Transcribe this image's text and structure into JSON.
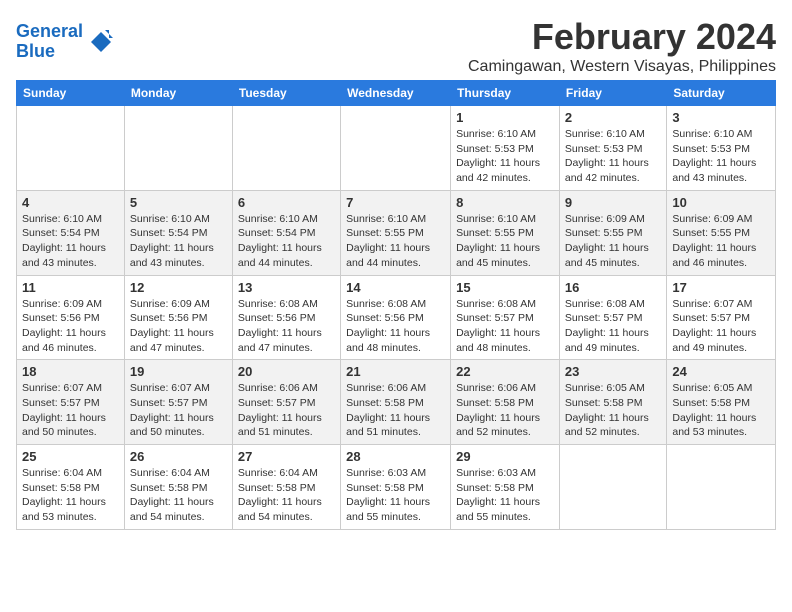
{
  "header": {
    "logo_line1": "General",
    "logo_line2": "Blue",
    "title": "February 2024",
    "subtitle": "Camingawan, Western Visayas, Philippines"
  },
  "days_of_week": [
    "Sunday",
    "Monday",
    "Tuesday",
    "Wednesday",
    "Thursday",
    "Friday",
    "Saturday"
  ],
  "weeks": [
    [
      {
        "day": "",
        "info": ""
      },
      {
        "day": "",
        "info": ""
      },
      {
        "day": "",
        "info": ""
      },
      {
        "day": "",
        "info": ""
      },
      {
        "day": "1",
        "info": "Sunrise: 6:10 AM\nSunset: 5:53 PM\nDaylight: 11 hours and 42 minutes."
      },
      {
        "day": "2",
        "info": "Sunrise: 6:10 AM\nSunset: 5:53 PM\nDaylight: 11 hours and 42 minutes."
      },
      {
        "day": "3",
        "info": "Sunrise: 6:10 AM\nSunset: 5:53 PM\nDaylight: 11 hours and 43 minutes."
      }
    ],
    [
      {
        "day": "4",
        "info": "Sunrise: 6:10 AM\nSunset: 5:54 PM\nDaylight: 11 hours and 43 minutes."
      },
      {
        "day": "5",
        "info": "Sunrise: 6:10 AM\nSunset: 5:54 PM\nDaylight: 11 hours and 43 minutes."
      },
      {
        "day": "6",
        "info": "Sunrise: 6:10 AM\nSunset: 5:54 PM\nDaylight: 11 hours and 44 minutes."
      },
      {
        "day": "7",
        "info": "Sunrise: 6:10 AM\nSunset: 5:55 PM\nDaylight: 11 hours and 44 minutes."
      },
      {
        "day": "8",
        "info": "Sunrise: 6:10 AM\nSunset: 5:55 PM\nDaylight: 11 hours and 45 minutes."
      },
      {
        "day": "9",
        "info": "Sunrise: 6:09 AM\nSunset: 5:55 PM\nDaylight: 11 hours and 45 minutes."
      },
      {
        "day": "10",
        "info": "Sunrise: 6:09 AM\nSunset: 5:55 PM\nDaylight: 11 hours and 46 minutes."
      }
    ],
    [
      {
        "day": "11",
        "info": "Sunrise: 6:09 AM\nSunset: 5:56 PM\nDaylight: 11 hours and 46 minutes."
      },
      {
        "day": "12",
        "info": "Sunrise: 6:09 AM\nSunset: 5:56 PM\nDaylight: 11 hours and 47 minutes."
      },
      {
        "day": "13",
        "info": "Sunrise: 6:08 AM\nSunset: 5:56 PM\nDaylight: 11 hours and 47 minutes."
      },
      {
        "day": "14",
        "info": "Sunrise: 6:08 AM\nSunset: 5:56 PM\nDaylight: 11 hours and 48 minutes."
      },
      {
        "day": "15",
        "info": "Sunrise: 6:08 AM\nSunset: 5:57 PM\nDaylight: 11 hours and 48 minutes."
      },
      {
        "day": "16",
        "info": "Sunrise: 6:08 AM\nSunset: 5:57 PM\nDaylight: 11 hours and 49 minutes."
      },
      {
        "day": "17",
        "info": "Sunrise: 6:07 AM\nSunset: 5:57 PM\nDaylight: 11 hours and 49 minutes."
      }
    ],
    [
      {
        "day": "18",
        "info": "Sunrise: 6:07 AM\nSunset: 5:57 PM\nDaylight: 11 hours and 50 minutes."
      },
      {
        "day": "19",
        "info": "Sunrise: 6:07 AM\nSunset: 5:57 PM\nDaylight: 11 hours and 50 minutes."
      },
      {
        "day": "20",
        "info": "Sunrise: 6:06 AM\nSunset: 5:57 PM\nDaylight: 11 hours and 51 minutes."
      },
      {
        "day": "21",
        "info": "Sunrise: 6:06 AM\nSunset: 5:58 PM\nDaylight: 11 hours and 51 minutes."
      },
      {
        "day": "22",
        "info": "Sunrise: 6:06 AM\nSunset: 5:58 PM\nDaylight: 11 hours and 52 minutes."
      },
      {
        "day": "23",
        "info": "Sunrise: 6:05 AM\nSunset: 5:58 PM\nDaylight: 11 hours and 52 minutes."
      },
      {
        "day": "24",
        "info": "Sunrise: 6:05 AM\nSunset: 5:58 PM\nDaylight: 11 hours and 53 minutes."
      }
    ],
    [
      {
        "day": "25",
        "info": "Sunrise: 6:04 AM\nSunset: 5:58 PM\nDaylight: 11 hours and 53 minutes."
      },
      {
        "day": "26",
        "info": "Sunrise: 6:04 AM\nSunset: 5:58 PM\nDaylight: 11 hours and 54 minutes."
      },
      {
        "day": "27",
        "info": "Sunrise: 6:04 AM\nSunset: 5:58 PM\nDaylight: 11 hours and 54 minutes."
      },
      {
        "day": "28",
        "info": "Sunrise: 6:03 AM\nSunset: 5:58 PM\nDaylight: 11 hours and 55 minutes."
      },
      {
        "day": "29",
        "info": "Sunrise: 6:03 AM\nSunset: 5:58 PM\nDaylight: 11 hours and 55 minutes."
      },
      {
        "day": "",
        "info": ""
      },
      {
        "day": "",
        "info": ""
      }
    ]
  ]
}
